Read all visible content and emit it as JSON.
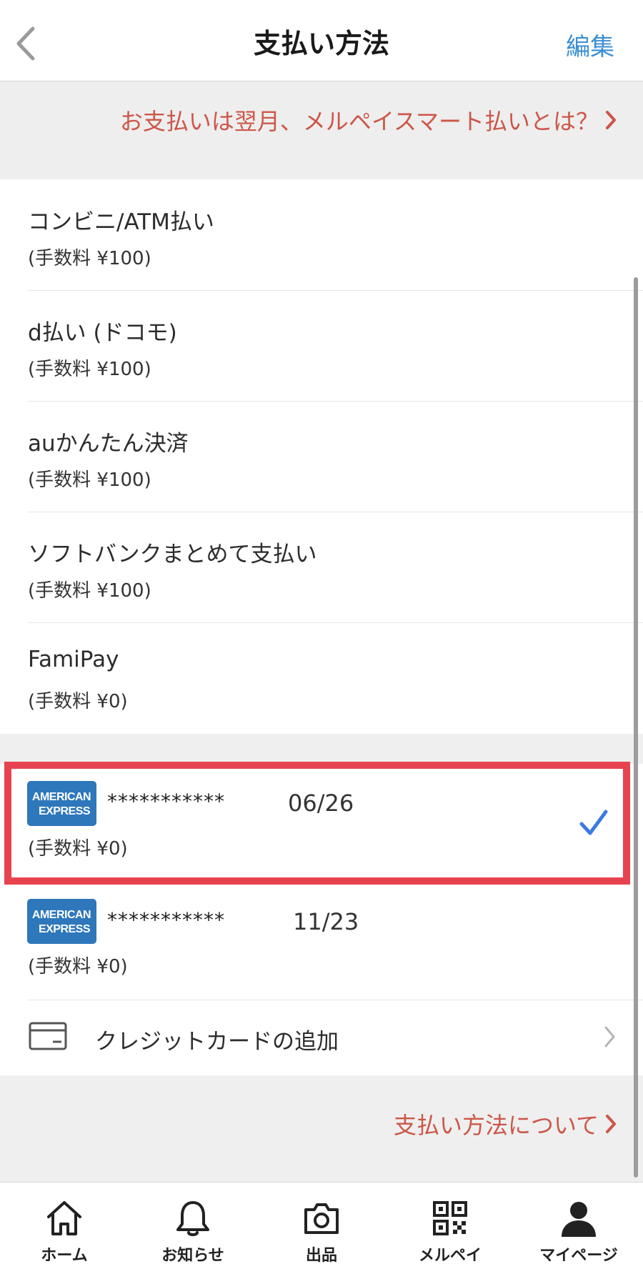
{
  "header": {
    "title": "支払い方法",
    "edit_label": "編集"
  },
  "banner": {
    "link_text": "お支払いは翌月、メルペイスマート払いとは？"
  },
  "payment_methods": [
    {
      "title": "コンビニ/ATM払い",
      "fee": "(手数料 ¥100)"
    },
    {
      "title": "d払い (ドコモ)",
      "fee": "(手数料 ¥100)"
    },
    {
      "title": "auかんたん決済",
      "fee": "(手数料 ¥100)"
    },
    {
      "title": "ソフトバンクまとめて支払い",
      "fee": "(手数料 ¥100)"
    },
    {
      "title": "FamiPay",
      "fee": "(手数料 ¥0)"
    }
  ],
  "cards": [
    {
      "brand": "AMERICAN EXPRESS",
      "masked_number": "***********",
      "expiry": "06/26",
      "fee": "(手数料 ¥0)",
      "selected": true
    },
    {
      "brand": "AMERICAN EXPRESS",
      "masked_number": "***********",
      "expiry": "11/23",
      "fee": "(手数料 ¥0)",
      "selected": false
    }
  ],
  "add_card": {
    "label": "クレジットカードの追加"
  },
  "footer_link": {
    "text": "支払い方法について"
  },
  "tabbar": {
    "items": [
      {
        "label": "ホーム",
        "icon": "home-icon"
      },
      {
        "label": "お知らせ",
        "icon": "bell-icon"
      },
      {
        "label": "出品",
        "icon": "camera-icon"
      },
      {
        "label": "メルペイ",
        "icon": "qr-code-icon"
      },
      {
        "label": "マイページ",
        "icon": "person-icon"
      }
    ]
  },
  "colors": {
    "accent_red": "#cd5648",
    "link_blue": "#3b8fd3",
    "highlight_red": "#e7434e",
    "amex_blue": "#2e77bb"
  }
}
